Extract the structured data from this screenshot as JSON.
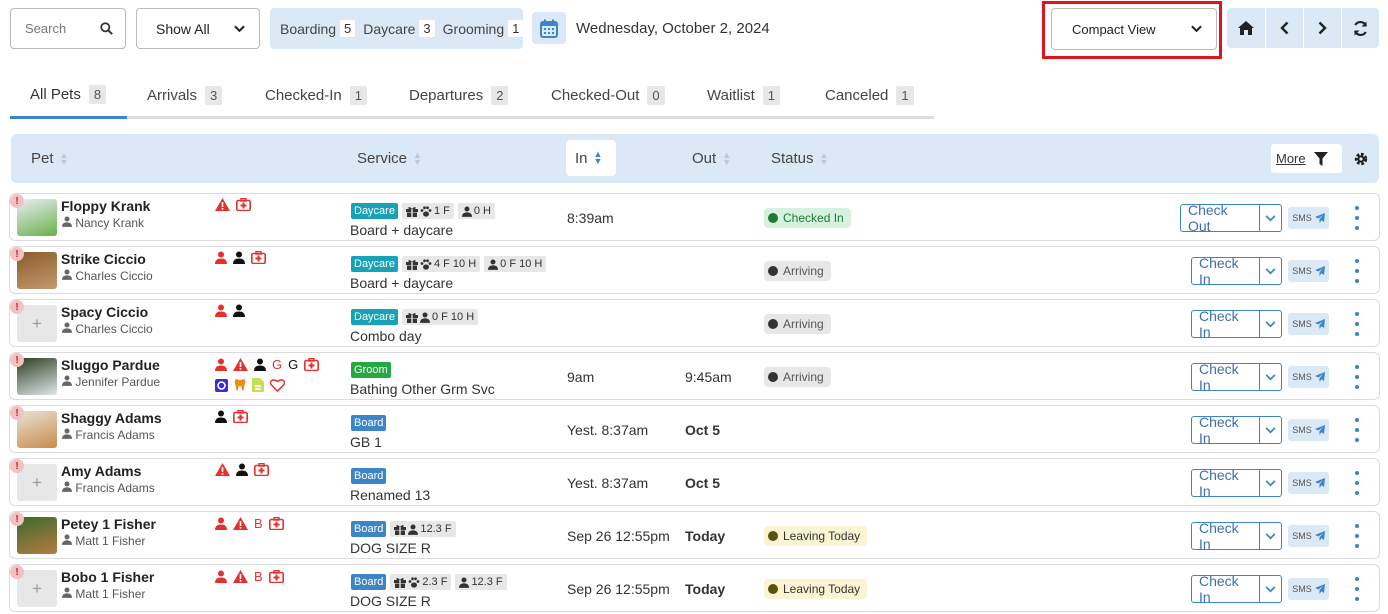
{
  "toolbar": {
    "search_placeholder": "Search",
    "show_all": "Show All",
    "counts": [
      {
        "label": "Boarding",
        "count": "5"
      },
      {
        "label": "Daycare",
        "count": "3"
      },
      {
        "label": "Grooming",
        "count": "1"
      }
    ],
    "date": "Wednesday, October 2, 2024",
    "view": "Compact View"
  },
  "tabs": [
    {
      "label": "All Pets",
      "count": "8"
    },
    {
      "label": "Arrivals",
      "count": "3"
    },
    {
      "label": "Checked-In",
      "count": "1"
    },
    {
      "label": "Departures",
      "count": "2"
    },
    {
      "label": "Checked-Out",
      "count": "0"
    },
    {
      "label": "Waitlist",
      "count": "1"
    },
    {
      "label": "Canceled",
      "count": "1"
    }
  ],
  "columns": {
    "pet": "Pet",
    "service": "Service",
    "in": "In",
    "out": "Out",
    "status": "Status",
    "more": "More"
  },
  "colors": {
    "accent": "#3d85c6",
    "daycare": "#17a2b8",
    "groom": "#28a745",
    "board": "#3d85c6",
    "alert": "#e53030"
  },
  "rows": [
    {
      "name": "Floppy Krank",
      "owner": "Nancy Krank",
      "service_tag": "Daycare",
      "chips": [
        "1 F",
        "0 H"
      ],
      "service": "Board + daycare",
      "in": "8:39am",
      "out": "",
      "status": "Checked In",
      "action": "Check Out",
      "sms": "SMS"
    },
    {
      "name": "Strike Ciccio",
      "owner": "Charles Ciccio",
      "service_tag": "Daycare",
      "chips": [
        "4 F 10 H",
        "0 F 10 H"
      ],
      "service": "Board + daycare",
      "in": "",
      "out": "",
      "status": "Arriving",
      "action": "Check In",
      "sms": "SMS"
    },
    {
      "name": "Spacy Ciccio",
      "owner": "Charles Ciccio",
      "service_tag": "Daycare",
      "chips": [
        "0 F 10 H"
      ],
      "service": "Combo day",
      "in": "",
      "out": "",
      "status": "Arriving",
      "action": "Check In",
      "sms": "SMS"
    },
    {
      "name": "Sluggo Pardue",
      "owner": "Jennifer Pardue",
      "service_tag": "Groom",
      "chips": [],
      "service": "Bathing Other Grm Svc",
      "in": "9am",
      "out": "9:45am",
      "status": "Arriving",
      "action": "Check In",
      "sms": "SMS"
    },
    {
      "name": "Shaggy Adams",
      "owner": "Francis Adams",
      "service_tag": "Board",
      "chips": [],
      "service": "GB 1",
      "in": "Yest. 8:37am",
      "out": "Oct 5",
      "status": "",
      "action": "Check In",
      "sms": "SMS"
    },
    {
      "name": "Amy Adams",
      "owner": "Francis Adams",
      "service_tag": "Board",
      "chips": [],
      "service": "Renamed 13",
      "in": "Yest. 8:37am",
      "out": "Oct 5",
      "status": "",
      "action": "Check In",
      "sms": "SMS"
    },
    {
      "name": "Petey 1 Fisher",
      "owner": "Matt 1 Fisher",
      "service_tag": "Board",
      "chips": [
        "12.3 F"
      ],
      "service": "DOG SIZE R",
      "in": "Sep 26 12:55pm",
      "out": "Today",
      "status": "Leaving Today",
      "action": "Check In",
      "sms": "SMS"
    },
    {
      "name": "Bobo 1 Fisher",
      "owner": "Matt 1 Fisher",
      "service_tag": "Board",
      "chips": [
        "2.3 F",
        "12.3 F"
      ],
      "service": "DOG SIZE R",
      "in": "Sep 26 12:55pm",
      "out": "Today",
      "status": "Leaving Today",
      "action": "Check In",
      "sms": "SMS"
    }
  ],
  "icon_letters": {
    "g": "G",
    "b": "B",
    "plus": "+"
  }
}
